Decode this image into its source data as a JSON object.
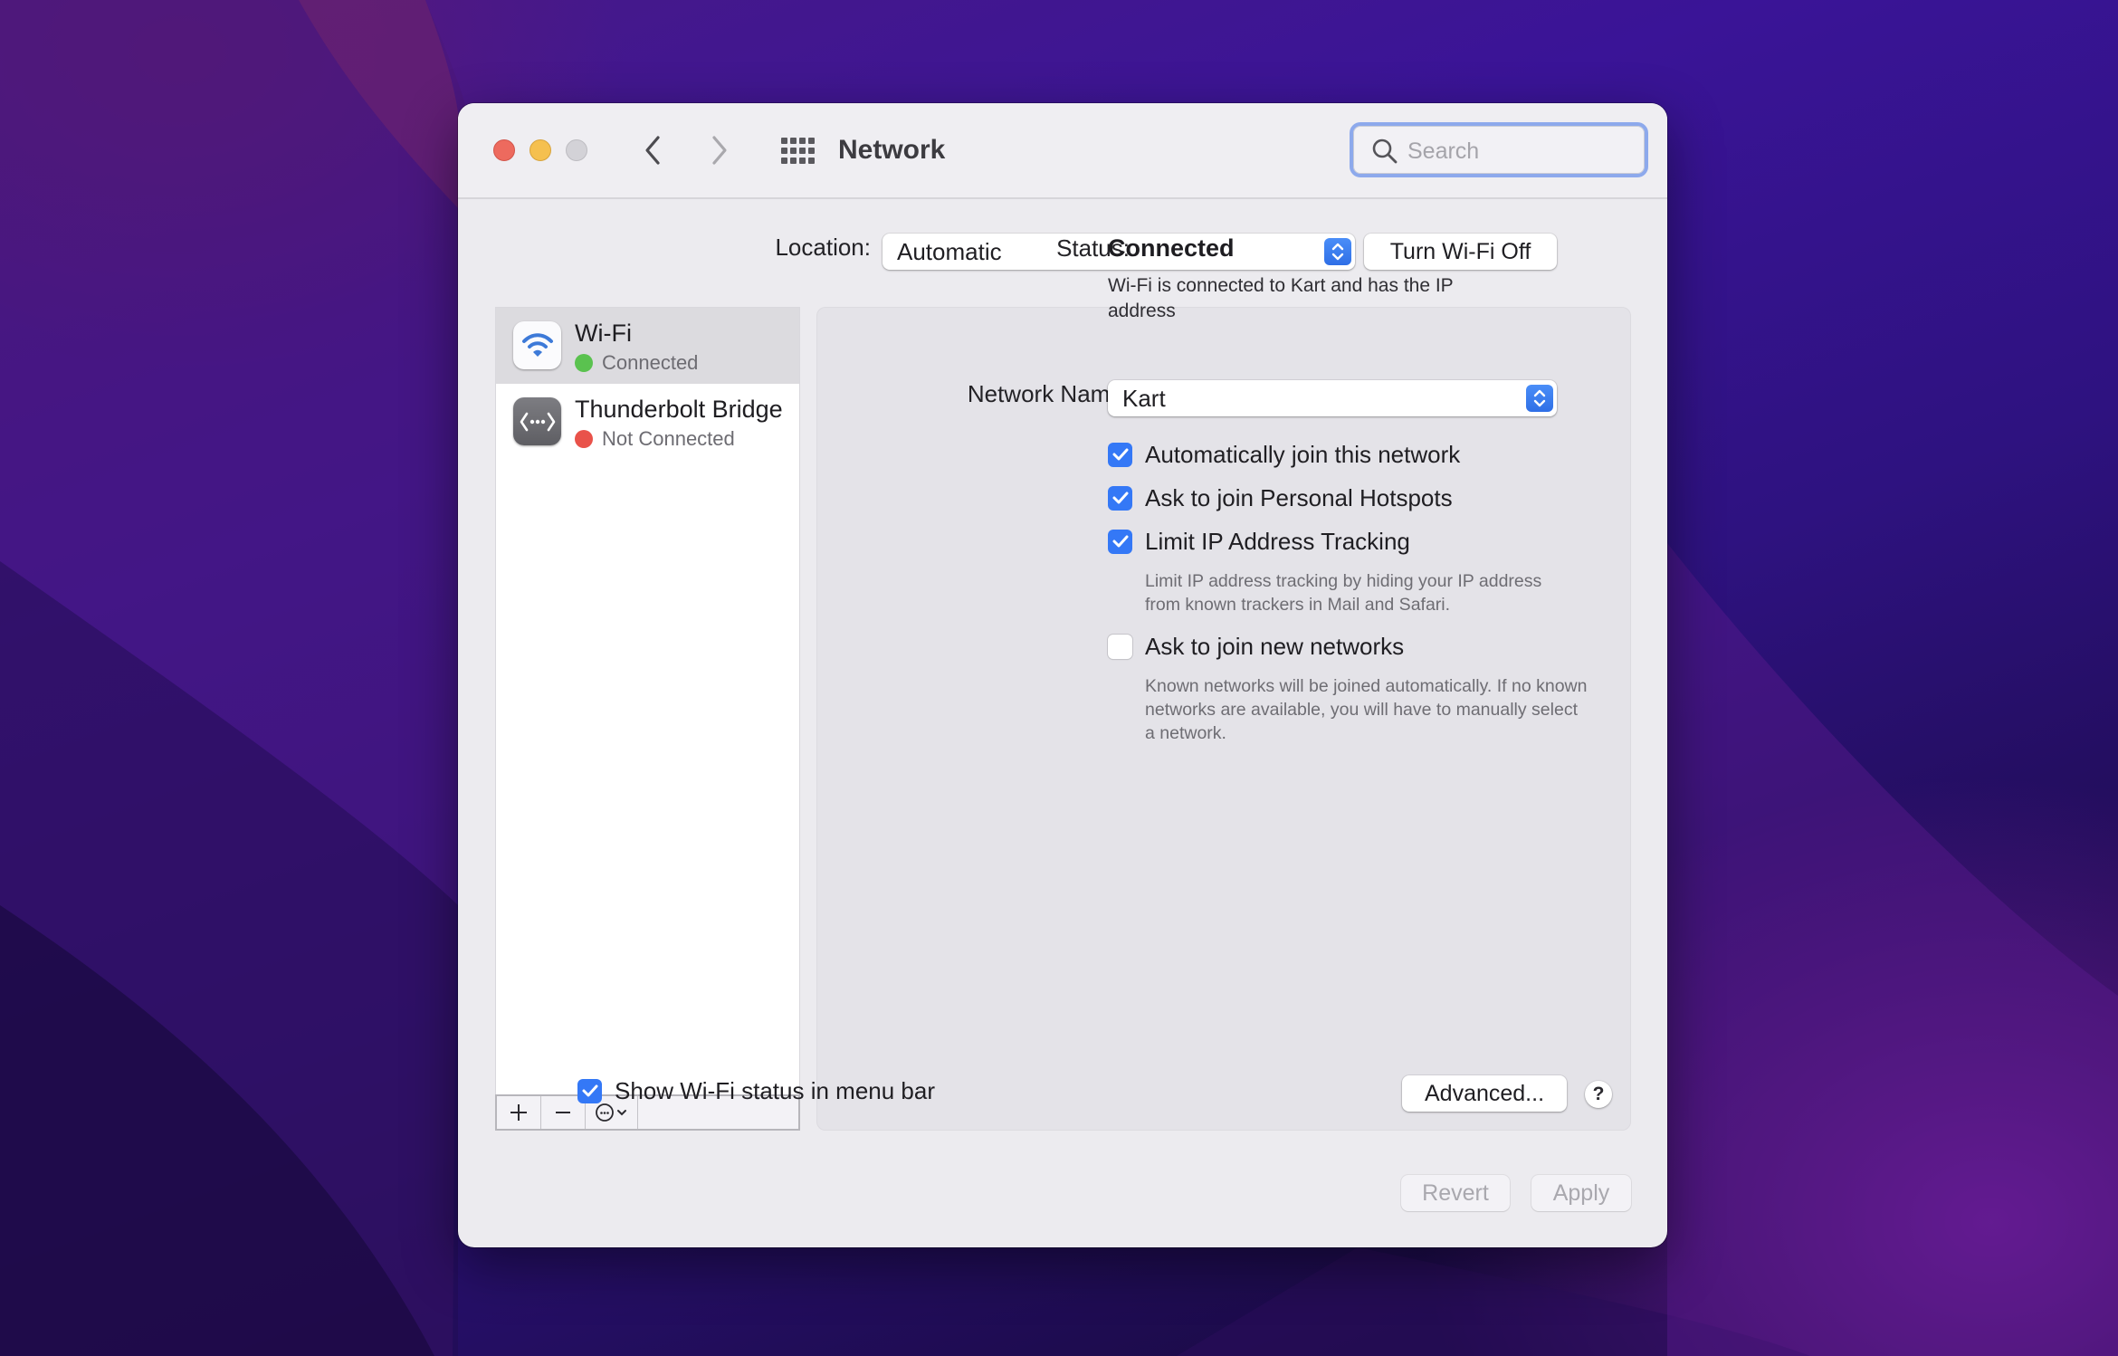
{
  "window": {
    "title": "Network",
    "search": {
      "placeholder": "Search",
      "value": ""
    }
  },
  "location": {
    "label": "Location:",
    "value": "Automatic"
  },
  "services": [
    {
      "name": "Wi-Fi",
      "status": "Connected",
      "status_color": "#5ac24f",
      "icon": "wifi-icon",
      "selected": true
    },
    {
      "name": "Thunderbolt Bridge",
      "status": "Not Connected",
      "status_color": "#e9524a",
      "icon": "thunderbolt-bridge-icon",
      "selected": false
    }
  ],
  "service_toolbar": {
    "add": "+",
    "remove": "−",
    "action": "⋯"
  },
  "detail": {
    "status_label": "Status:",
    "status_value": "Connected",
    "turn_off_button": "Turn Wi-Fi Off",
    "status_description": "Wi-Fi is connected to Kart and has the IP address",
    "network_name_label": "Network Name:",
    "network_name_value": "Kart",
    "options": [
      {
        "label": "Automatically join this network",
        "checked": true
      },
      {
        "label": "Ask to join Personal Hotspots",
        "checked": true
      },
      {
        "label": "Limit IP Address Tracking",
        "checked": true,
        "description": "Limit IP address tracking by hiding your IP address from known trackers in Mail and Safari."
      },
      {
        "label": "Ask to join new networks",
        "checked": false,
        "description": "Known networks will be joined automatically. If no known networks are available, you will have to manually select a network."
      }
    ],
    "show_status_label": "Show Wi-Fi status in menu bar",
    "show_status_checked": true,
    "advanced_button": "Advanced...",
    "help_button": "?"
  },
  "footer": {
    "revert": "Revert",
    "apply": "Apply"
  },
  "colors": {
    "accent": "#3478f6",
    "connected": "#5ac24f",
    "not_connected": "#e9524a"
  }
}
